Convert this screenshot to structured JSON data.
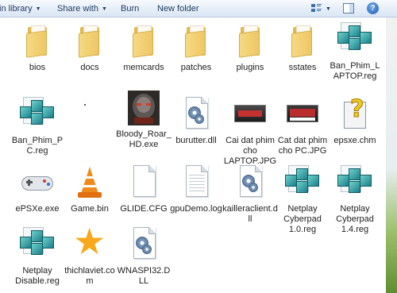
{
  "toolbar": {
    "include_library_label": "in library",
    "share_with_label": "Share with",
    "burn_label": "Burn",
    "new_folder_label": "New folder",
    "help_label": "?"
  },
  "files": [
    {
      "label": "bios",
      "icon": "folder-icon"
    },
    {
      "label": "docs",
      "icon": "folder-icon"
    },
    {
      "label": "memcards",
      "icon": "folder-icon"
    },
    {
      "label": "patches",
      "icon": "folder-icon"
    },
    {
      "label": "plugins",
      "icon": "folder-icon"
    },
    {
      "label": "sstates",
      "icon": "folder-icon"
    },
    {
      "label": "Ban_Phim_LAPTOP.reg",
      "icon": "registry-file-icon"
    },
    {
      "label": "Ban_Phim_PC.reg",
      "icon": "registry-file-icon"
    },
    {
      "label": "Bloody_Roar_HD.exe",
      "icon": "game-executable-icon"
    },
    {
      "label": "burutter.dll",
      "icon": "dll-file-icon"
    },
    {
      "label": "Cai dat phim cho LAPTOP.JPG",
      "icon": "jpg-image-icon"
    },
    {
      "label": "Cat dat phim cho PC.JPG",
      "icon": "jpg-image-icon"
    },
    {
      "label": "epsxe.chm",
      "icon": "help-file-icon"
    },
    {
      "label": "ePSXe.exe",
      "icon": "controller-icon"
    },
    {
      "label": "Game.bin",
      "icon": "vlc-cone-icon"
    },
    {
      "label": "GLIDE.CFG",
      "icon": "blank-file-icon"
    },
    {
      "label": "gpuDemo.log",
      "icon": "text-document-icon"
    },
    {
      "label": "kailleraclient.dll",
      "icon": "dll-file-icon"
    },
    {
      "label": "Netplay Cyberpad 1.0.reg",
      "icon": "registry-file-icon"
    },
    {
      "label": "Netplay Cyberpad 1.4.reg",
      "icon": "registry-file-icon"
    },
    {
      "label": "Netplay Disable.reg",
      "icon": "registry-file-icon"
    },
    {
      "label": "thichlaviet.com",
      "icon": "star-file-icon"
    },
    {
      "label": "WNASPI32.DLL",
      "icon": "dll-file-icon"
    }
  ]
}
